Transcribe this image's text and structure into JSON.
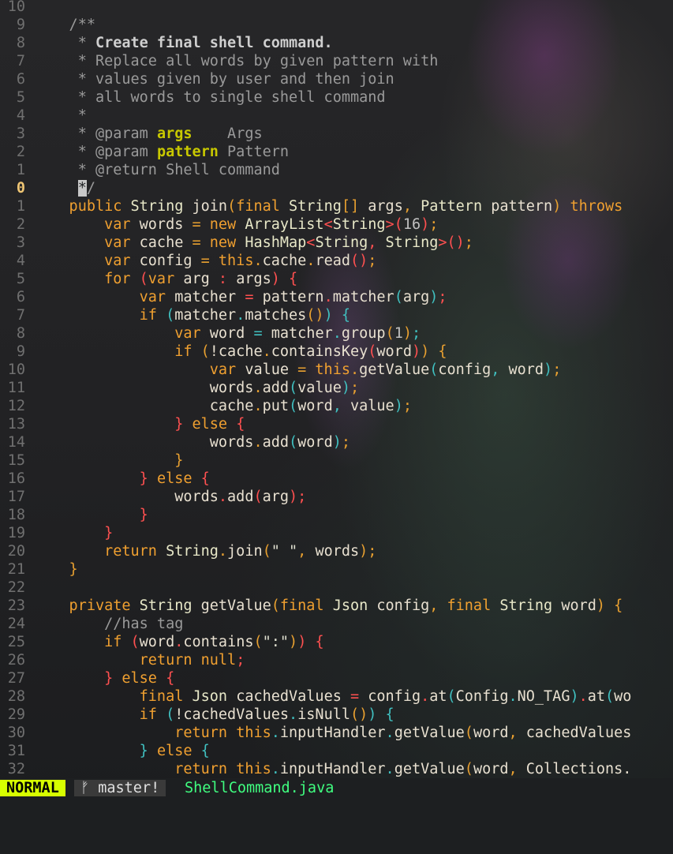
{
  "lines": [
    {
      "num": "10",
      "cur": false,
      "tokens": []
    },
    {
      "num": "9",
      "cur": false,
      "tokens": [
        [
          "cm",
          "    /**"
        ]
      ]
    },
    {
      "num": "8",
      "cur": false,
      "tokens": [
        [
          "cm",
          "     * "
        ],
        [
          "cmb",
          "Create final shell command."
        ]
      ]
    },
    {
      "num": "7",
      "cur": false,
      "tokens": [
        [
          "cm",
          "     * Replace all words by given pattern with"
        ]
      ]
    },
    {
      "num": "6",
      "cur": false,
      "tokens": [
        [
          "cm",
          "     * values given by user and then join"
        ]
      ]
    },
    {
      "num": "5",
      "cur": false,
      "tokens": [
        [
          "cm",
          "     * all words to single shell command"
        ]
      ]
    },
    {
      "num": "4",
      "cur": false,
      "tokens": [
        [
          "cm",
          "     *"
        ]
      ]
    },
    {
      "num": "3",
      "cur": false,
      "tokens": [
        [
          "cm",
          "     * @param "
        ],
        [
          "pn",
          "args"
        ],
        [
          "cm",
          "    Args"
        ]
      ]
    },
    {
      "num": "2",
      "cur": false,
      "tokens": [
        [
          "cm",
          "     * @param "
        ],
        [
          "pn",
          "pattern"
        ],
        [
          "cm",
          " Pattern"
        ]
      ]
    },
    {
      "num": "1",
      "cur": false,
      "tokens": [
        [
          "cm",
          "     * @return Shell command"
        ]
      ]
    },
    {
      "num": "0",
      "cur": true,
      "tokens": [
        [
          "cm",
          "     "
        ],
        [
          "cursor",
          "*"
        ],
        [
          "cm",
          "/"
        ]
      ]
    },
    {
      "num": "1",
      "cur": false,
      "tokens": [
        [
          "kw",
          "    public "
        ],
        [
          "ty",
          "String "
        ],
        [
          "fn",
          "join"
        ],
        [
          "br1",
          "("
        ],
        [
          "kw",
          "final "
        ],
        [
          "ty",
          "String"
        ],
        [
          "br1",
          "[] "
        ],
        [
          "id",
          "args"
        ],
        [
          "br1",
          ", "
        ],
        [
          "ty",
          "Pattern "
        ],
        [
          "id",
          "pattern"
        ],
        [
          "br1",
          ") "
        ],
        [
          "kw",
          "throws "
        ]
      ]
    },
    {
      "num": "2",
      "cur": false,
      "tokens": [
        [
          "kw",
          "        var "
        ],
        [
          "id",
          "words "
        ],
        [
          "br1",
          "= "
        ],
        [
          "kw",
          "new "
        ],
        [
          "ty",
          "ArrayList"
        ],
        [
          "br2",
          "<"
        ],
        [
          "ty",
          "String"
        ],
        [
          "br2",
          ">("
        ],
        [
          "nm",
          "16"
        ],
        [
          "br2",
          ")"
        ],
        [
          "br1",
          ";"
        ]
      ]
    },
    {
      "num": "3",
      "cur": false,
      "tokens": [
        [
          "kw",
          "        var "
        ],
        [
          "id",
          "cache "
        ],
        [
          "br1",
          "= "
        ],
        [
          "kw",
          "new "
        ],
        [
          "ty",
          "HashMap"
        ],
        [
          "br2",
          "<"
        ],
        [
          "ty",
          "String"
        ],
        [
          "br2",
          ", "
        ],
        [
          "ty",
          "String"
        ],
        [
          "br2",
          ">()"
        ],
        [
          "br1",
          ";"
        ]
      ]
    },
    {
      "num": "4",
      "cur": false,
      "tokens": [
        [
          "kw",
          "        var "
        ],
        [
          "id",
          "config "
        ],
        [
          "br1",
          "= "
        ],
        [
          "kw",
          "this"
        ],
        [
          "br1",
          "."
        ],
        [
          "id",
          "cache"
        ],
        [
          "br1",
          "."
        ],
        [
          "fn",
          "read"
        ],
        [
          "br2",
          "()"
        ],
        [
          "br1",
          ";"
        ]
      ]
    },
    {
      "num": "5",
      "cur": false,
      "tokens": [
        [
          "kw",
          "        for "
        ],
        [
          "br2",
          "("
        ],
        [
          "kw",
          "var "
        ],
        [
          "id",
          "arg "
        ],
        [
          "br2",
          ": "
        ],
        [
          "id",
          "args"
        ],
        [
          "br2",
          ") {"
        ]
      ]
    },
    {
      "num": "6",
      "cur": false,
      "tokens": [
        [
          "kw",
          "            var "
        ],
        [
          "id",
          "matcher "
        ],
        [
          "br2",
          "= "
        ],
        [
          "id",
          "pattern"
        ],
        [
          "br2",
          "."
        ],
        [
          "fn",
          "matcher"
        ],
        [
          "br3",
          "("
        ],
        [
          "id",
          "arg"
        ],
        [
          "br3",
          ")"
        ],
        [
          "br2",
          ";"
        ]
      ]
    },
    {
      "num": "7",
      "cur": false,
      "tokens": [
        [
          "kw",
          "            if "
        ],
        [
          "br3",
          "("
        ],
        [
          "id",
          "matcher"
        ],
        [
          "br3",
          "."
        ],
        [
          "fn",
          "matches"
        ],
        [
          "br1",
          "()"
        ],
        [
          "br3",
          ") {"
        ]
      ]
    },
    {
      "num": "8",
      "cur": false,
      "tokens": [
        [
          "kw",
          "                var "
        ],
        [
          "id",
          "word "
        ],
        [
          "br3",
          "= "
        ],
        [
          "id",
          "matcher"
        ],
        [
          "br3",
          "."
        ],
        [
          "fn",
          "group"
        ],
        [
          "br1",
          "("
        ],
        [
          "nm",
          "1"
        ],
        [
          "br1",
          ")"
        ],
        [
          "br3",
          ";"
        ]
      ]
    },
    {
      "num": "9",
      "cur": false,
      "tokens": [
        [
          "kw",
          "                if "
        ],
        [
          "br1",
          "("
        ],
        [
          "id",
          "!cache"
        ],
        [
          "br1",
          "."
        ],
        [
          "fn",
          "containsKey"
        ],
        [
          "br2",
          "("
        ],
        [
          "id",
          "word"
        ],
        [
          "br2",
          ")"
        ],
        [
          "br1",
          ") {"
        ]
      ]
    },
    {
      "num": "10",
      "cur": false,
      "tokens": [
        [
          "kw",
          "                    var "
        ],
        [
          "id",
          "value "
        ],
        [
          "br1",
          "= "
        ],
        [
          "kw",
          "this"
        ],
        [
          "br1",
          "."
        ],
        [
          "fn",
          "getValue"
        ],
        [
          "br3",
          "("
        ],
        [
          "id",
          "config"
        ],
        [
          "br3",
          ", "
        ],
        [
          "id",
          "word"
        ],
        [
          "br3",
          ")"
        ],
        [
          "br1",
          ";"
        ]
      ]
    },
    {
      "num": "11",
      "cur": false,
      "tokens": [
        [
          "id",
          "                    words"
        ],
        [
          "br1",
          "."
        ],
        [
          "fn",
          "add"
        ],
        [
          "br3",
          "("
        ],
        [
          "id",
          "value"
        ],
        [
          "br3",
          ")"
        ],
        [
          "br1",
          ";"
        ]
      ]
    },
    {
      "num": "12",
      "cur": false,
      "tokens": [
        [
          "id",
          "                    cache"
        ],
        [
          "br1",
          "."
        ],
        [
          "fn",
          "put"
        ],
        [
          "br3",
          "("
        ],
        [
          "id",
          "word"
        ],
        [
          "br3",
          ", "
        ],
        [
          "id",
          "value"
        ],
        [
          "br3",
          ")"
        ],
        [
          "br1",
          ";"
        ]
      ]
    },
    {
      "num": "13",
      "cur": false,
      "tokens": [
        [
          "br2",
          "                } "
        ],
        [
          "kw",
          "else "
        ],
        [
          "br2",
          "{"
        ]
      ]
    },
    {
      "num": "14",
      "cur": false,
      "tokens": [
        [
          "id",
          "                    words"
        ],
        [
          "br1",
          "."
        ],
        [
          "fn",
          "add"
        ],
        [
          "br3",
          "("
        ],
        [
          "id",
          "word"
        ],
        [
          "br3",
          ")"
        ],
        [
          "br1",
          ";"
        ]
      ]
    },
    {
      "num": "15",
      "cur": false,
      "tokens": [
        [
          "br1",
          "                }"
        ]
      ]
    },
    {
      "num": "16",
      "cur": false,
      "tokens": [
        [
          "br2",
          "            } "
        ],
        [
          "kw",
          "else "
        ],
        [
          "br2",
          "{"
        ]
      ]
    },
    {
      "num": "17",
      "cur": false,
      "tokens": [
        [
          "id",
          "                words"
        ],
        [
          "br2",
          "."
        ],
        [
          "fn",
          "add"
        ],
        [
          "br2",
          "("
        ],
        [
          "id",
          "arg"
        ],
        [
          "br2",
          ")"
        ],
        [
          "br2",
          ";"
        ]
      ]
    },
    {
      "num": "18",
      "cur": false,
      "tokens": [
        [
          "br2",
          "            }"
        ]
      ]
    },
    {
      "num": "19",
      "cur": false,
      "tokens": [
        [
          "br2",
          "        }"
        ]
      ]
    },
    {
      "num": "20",
      "cur": false,
      "tokens": [
        [
          "kw",
          "        return "
        ],
        [
          "ty",
          "String"
        ],
        [
          "br1",
          "."
        ],
        [
          "fn",
          "join"
        ],
        [
          "br1",
          "("
        ],
        [
          "st",
          "\" \""
        ],
        [
          "br1",
          ", "
        ],
        [
          "id",
          "words"
        ],
        [
          "br1",
          ")"
        ],
        [
          "br1",
          ";"
        ]
      ]
    },
    {
      "num": "21",
      "cur": false,
      "tokens": [
        [
          "br1",
          "    }"
        ]
      ]
    },
    {
      "num": "22",
      "cur": false,
      "tokens": []
    },
    {
      "num": "23",
      "cur": false,
      "tokens": [
        [
          "kw",
          "    private "
        ],
        [
          "ty",
          "String "
        ],
        [
          "fn",
          "getValue"
        ],
        [
          "br1",
          "("
        ],
        [
          "kw",
          "final "
        ],
        [
          "ty",
          "Json "
        ],
        [
          "id",
          "config"
        ],
        [
          "br1",
          ", "
        ],
        [
          "kw",
          "final "
        ],
        [
          "ty",
          "String "
        ],
        [
          "id",
          "word"
        ],
        [
          "br1",
          ") {"
        ]
      ]
    },
    {
      "num": "24",
      "cur": false,
      "tokens": [
        [
          "cm",
          "        //has tag"
        ]
      ]
    },
    {
      "num": "25",
      "cur": false,
      "tokens": [
        [
          "kw",
          "        if "
        ],
        [
          "br2",
          "("
        ],
        [
          "id",
          "word"
        ],
        [
          "br2",
          "."
        ],
        [
          "fn",
          "contains"
        ],
        [
          "br1",
          "("
        ],
        [
          "st",
          "\":\""
        ],
        [
          "br1",
          ")"
        ],
        [
          "br2",
          ") {"
        ]
      ]
    },
    {
      "num": "26",
      "cur": false,
      "tokens": [
        [
          "kw",
          "            return "
        ],
        [
          "kw",
          "null"
        ],
        [
          "br2",
          ";"
        ]
      ]
    },
    {
      "num": "27",
      "cur": false,
      "tokens": [
        [
          "br2",
          "        } "
        ],
        [
          "kw",
          "else "
        ],
        [
          "br2",
          "{"
        ]
      ]
    },
    {
      "num": "28",
      "cur": false,
      "tokens": [
        [
          "kw",
          "            final "
        ],
        [
          "ty",
          "Json "
        ],
        [
          "id",
          "cachedValues "
        ],
        [
          "br2",
          "= "
        ],
        [
          "id",
          "config"
        ],
        [
          "br2",
          "."
        ],
        [
          "fn",
          "at"
        ],
        [
          "br3",
          "("
        ],
        [
          "id",
          "Config"
        ],
        [
          "br3",
          "."
        ],
        [
          "id",
          "NO_TAG"
        ],
        [
          "br3",
          ")"
        ],
        [
          "br2",
          "."
        ],
        [
          "fn",
          "at"
        ],
        [
          "br3",
          "("
        ],
        [
          "id",
          "wo"
        ]
      ]
    },
    {
      "num": "29",
      "cur": false,
      "tokens": [
        [
          "kw",
          "            if "
        ],
        [
          "br3",
          "("
        ],
        [
          "id",
          "!cachedValues"
        ],
        [
          "br3",
          "."
        ],
        [
          "fn",
          "isNull"
        ],
        [
          "br1",
          "()"
        ],
        [
          "br3",
          ") {"
        ]
      ]
    },
    {
      "num": "30",
      "cur": false,
      "tokens": [
        [
          "kw",
          "                return "
        ],
        [
          "kw",
          "this"
        ],
        [
          "br3",
          "."
        ],
        [
          "id",
          "inputHandler"
        ],
        [
          "br3",
          "."
        ],
        [
          "fn",
          "getValue"
        ],
        [
          "br1",
          "("
        ],
        [
          "id",
          "word"
        ],
        [
          "br1",
          ", "
        ],
        [
          "id",
          "cachedValues"
        ]
      ]
    },
    {
      "num": "31",
      "cur": false,
      "tokens": [
        [
          "br3",
          "            } "
        ],
        [
          "kw",
          "else "
        ],
        [
          "br3",
          "{"
        ]
      ]
    },
    {
      "num": "32",
      "cur": false,
      "tokens": [
        [
          "kw",
          "                return "
        ],
        [
          "kw",
          "this"
        ],
        [
          "br3",
          "."
        ],
        [
          "id",
          "inputHandler"
        ],
        [
          "br3",
          "."
        ],
        [
          "fn",
          "getValue"
        ],
        [
          "br1",
          "("
        ],
        [
          "id",
          "word"
        ],
        [
          "br1",
          ", "
        ],
        [
          "id",
          "Collections."
        ]
      ]
    }
  ],
  "statusline": {
    "mode": "NORMAL",
    "branch_icon": "ᚠ",
    "branch": "master!",
    "file": "ShellCommand.java"
  }
}
